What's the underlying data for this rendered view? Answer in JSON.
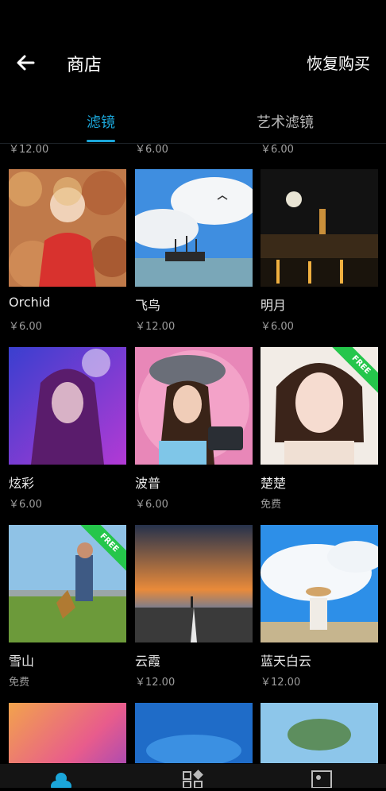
{
  "header": {
    "title": "商店",
    "restore_label": "恢复购买"
  },
  "tabs": [
    {
      "label": "滤镜",
      "active": true
    },
    {
      "label": "艺术滤镜",
      "active": false
    }
  ],
  "top_prices": [
    "￥12.00",
    "￥6.00",
    "￥6.00"
  ],
  "items": [
    {
      "name": "Orchid",
      "price": "￥6.00"
    },
    {
      "name": "飞鸟",
      "price": "￥12.00"
    },
    {
      "name": "明月",
      "price": "￥6.00"
    },
    {
      "name": "炫彩",
      "price": "￥6.00"
    },
    {
      "name": "波普",
      "price": "￥6.00"
    },
    {
      "name": "楚楚",
      "price": "免费",
      "badge": "FREE"
    },
    {
      "name": "雪山",
      "price": "免费",
      "badge": "FREE"
    },
    {
      "name": "云霞",
      "price": "￥12.00"
    },
    {
      "name": "蓝天白云",
      "price": "￥12.00"
    }
  ],
  "colors": {
    "accent": "#1ba6d9",
    "badge": "#25c64b",
    "background": "#000000"
  },
  "bottom_nav": [
    "filter-circles-icon",
    "grid-icon",
    "gallery-icon"
  ]
}
